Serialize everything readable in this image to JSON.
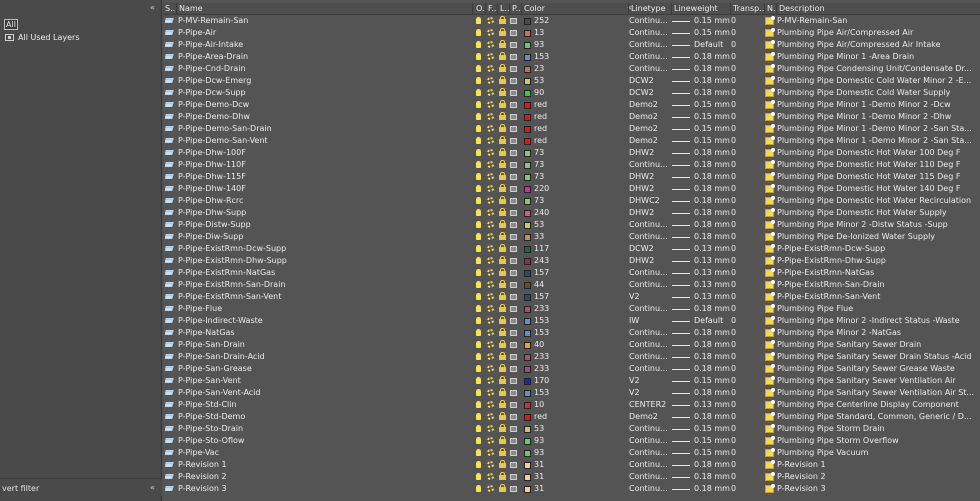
{
  "filter_tree": {
    "collapse_glyph": "«",
    "items": [
      {
        "label": "All"
      },
      {
        "label": "All Used Layers"
      }
    ],
    "invert_filter_label": "vert filter"
  },
  "columns": {
    "status": "S..",
    "name": "Name",
    "on": "O..",
    "freeze": "F..",
    "lock": "L..",
    "plot": "P..",
    "color": "Color",
    "linetype": "Linetype",
    "lineweight": "Lineweight",
    "transparency": "Transp...",
    "new_vp_freeze": "N..",
    "description": "Description"
  },
  "colors": {
    "252": "#4a4a4a",
    "13": "#d2686c",
    "93": "#5fd05f",
    "153": "#5f91cf",
    "23": "#d36a4f",
    "53": "#c8c866",
    "90": "#18e02a",
    "red": "#ee1111",
    "73": "#86c770",
    "220": "#e020b0",
    "240": "#e2547c",
    "33": "#c88a58",
    "117": "#1d6a3a",
    "243": "#9a2a4a",
    "157": "#2b4a66",
    "44": "#6a4e12",
    "233": "#a84d7b",
    "40": "#eda61a",
    "170": "#2020c8",
    "10": "#ee2222",
    "31": "#f5cd98"
  },
  "layers": [
    {
      "name": "P-MV-Remain-San",
      "color": "252",
      "linetype": "Continu...",
      "lineweight": "0.15 mm",
      "transparency": "0",
      "description": "P-MV-Remain-San"
    },
    {
      "name": "P-Pipe-Air",
      "color": "13",
      "linetype": "Continu...",
      "lineweight": "0.15 mm",
      "transparency": "0",
      "description": "Plumbing Pipe Air/Compressed Air"
    },
    {
      "name": "P-Pipe-Air-Intake",
      "color": "93",
      "linetype": "Continu...",
      "lineweight": "Default",
      "transparency": "0",
      "description": "Plumbing Pipe Air/Compressed Air Intake"
    },
    {
      "name": "P-Pipe-Area-Drain",
      "color": "153",
      "linetype": "Continu...",
      "lineweight": "0.18 mm",
      "transparency": "0",
      "description": "Plumbing Pipe Minor 1 -Area Drain"
    },
    {
      "name": "P-Pipe-Cnd-Drain",
      "color": "23",
      "linetype": "Continu...",
      "lineweight": "0.18 mm",
      "transparency": "0",
      "description": "Plumbing  Pipe Condensing  Unit/Condensate  Dr..."
    },
    {
      "name": "P-Pipe-Dcw-Emerg",
      "color": "53",
      "linetype": "DCW2",
      "lineweight": "0.18 mm",
      "transparency": "0",
      "description": "Plumbing Pipe Domestic Cold Water Minor 2 -E..."
    },
    {
      "name": "P-Pipe-Dcw-Supp",
      "color": "90",
      "linetype": "DCW2",
      "lineweight": "0.18 mm",
      "transparency": "0",
      "description": "Plumbing Pipe Domestic Cold Water Supply"
    },
    {
      "name": "P-Pipe-Demo-Dcw",
      "color": "red",
      "linetype": "Demo2",
      "lineweight": "0.15 mm",
      "transparency": "0",
      "description": "Plumbing Pipe Minor 1 -Demo Minor 2 -Dcw"
    },
    {
      "name": "P-Pipe-Demo-Dhw",
      "color": "red",
      "linetype": "Demo2",
      "lineweight": "0.15 mm",
      "transparency": "0",
      "description": "Plumbing Pipe Minor 1 -Demo Minor 2 -Dhw"
    },
    {
      "name": "P-Pipe-Demo-San-Drain",
      "color": "red",
      "linetype": "Demo2",
      "lineweight": "0.15 mm",
      "transparency": "0",
      "description": "Plumbing Pipe Minor 1 -Demo Minor 2 -San Sta..."
    },
    {
      "name": "P-Pipe-Demo-San-Vent",
      "color": "red",
      "linetype": "Demo2",
      "lineweight": "0.15 mm",
      "transparency": "0",
      "description": "Plumbing Pipe Minor 1 -Demo Minor 2 -San Sta..."
    },
    {
      "name": "P-Pipe-Dhw-100F",
      "color": "73",
      "linetype": "DHW2",
      "lineweight": "0.18 mm",
      "transparency": "0",
      "description": "Plumbing Pipe Domestic Hot Water 100 Deg F"
    },
    {
      "name": "P-Pipe-Dhw-110F",
      "color": "73",
      "linetype": "Continu...",
      "lineweight": "0.18 mm",
      "transparency": "0",
      "description": "Plumbing Pipe Domestic Hot Water 110 Deg F"
    },
    {
      "name": "P-Pipe-Dhw-115F",
      "color": "73",
      "linetype": "DHW2",
      "lineweight": "0.18 mm",
      "transparency": "0",
      "description": "Plumbing Pipe Domestic Hot Water 115 Deg F"
    },
    {
      "name": "P-Pipe-Dhw-140F",
      "color": "220",
      "linetype": "DHW2",
      "lineweight": "0.18 mm",
      "transparency": "0",
      "description": "Plumbing Pipe Domestic Hot Water 140 Deg F"
    },
    {
      "name": "P-Pipe-Dhw-Rcrc",
      "color": "73",
      "linetype": "DHWC2",
      "lineweight": "0.18 mm",
      "transparency": "0",
      "description": "Plumbing Pipe Domestic Hot Water Recirculation"
    },
    {
      "name": "P-Pipe-Dhw-Supp",
      "color": "240",
      "linetype": "DHW2",
      "lineweight": "0.18 mm",
      "transparency": "0",
      "description": "Plumbing Pipe Domestic Hot Water Supply"
    },
    {
      "name": "P-Pipe-Distw-Supp",
      "color": "53",
      "linetype": "Continu...",
      "lineweight": "0.18 mm",
      "transparency": "0",
      "description": "Plumbing Pipe Minor 2 -Distw Status -Supp"
    },
    {
      "name": "P-Pipe-Diw-Supp",
      "color": "33",
      "linetype": "Continu...",
      "lineweight": "0.18 mm",
      "transparency": "0",
      "description": "Plumbing Pipe De-Ionized Water Supply"
    },
    {
      "name": "P-Pipe-ExistRmn-Dcw-Supp",
      "color": "117",
      "linetype": "DCW2",
      "lineweight": "0.13 mm",
      "transparency": "0",
      "description": "P-Pipe-ExistRmn-Dcw-Supp"
    },
    {
      "name": "P-Pipe-ExistRmn-Dhw-Supp",
      "color": "243",
      "linetype": "DHW2",
      "lineweight": "0.13 mm",
      "transparency": "0",
      "description": "P-Pipe-ExistRmn-Dhw-Supp"
    },
    {
      "name": "P-Pipe-ExistRmn-NatGas",
      "color": "157",
      "linetype": "Continu...",
      "lineweight": "0.13 mm",
      "transparency": "0",
      "description": "P-Pipe-ExistRmn-NatGas"
    },
    {
      "name": "P-Pipe-ExistRmn-San-Drain",
      "color": "44",
      "linetype": "Continu...",
      "lineweight": "0.13 mm",
      "transparency": "0",
      "description": "P-Pipe-ExistRmn-San-Drain"
    },
    {
      "name": "P-Pipe-ExistRmn-San-Vent",
      "color": "157",
      "linetype": "V2",
      "lineweight": "0.13 mm",
      "transparency": "0",
      "description": "P-Pipe-ExistRmn-San-Vent"
    },
    {
      "name": "P-Pipe-Flue",
      "color": "233",
      "linetype": "Continu...",
      "lineweight": "0.18 mm",
      "transparency": "0",
      "description": "Plumbing Pipe Flue"
    },
    {
      "name": "P-Pipe-Indirect-Waste",
      "color": "153",
      "linetype": "IW",
      "lineweight": "Default",
      "transparency": "0",
      "description": "Plumbing Pipe Minor 2 -Indirect Status -Waste"
    },
    {
      "name": "P-Pipe-NatGas",
      "color": "153",
      "linetype": "Continu...",
      "lineweight": "0.18 mm",
      "transparency": "0",
      "description": "Plumbing Pipe Minor 2 -NatGas"
    },
    {
      "name": "P-Pipe-San-Drain",
      "color": "40",
      "linetype": "Continu...",
      "lineweight": "0.18 mm",
      "transparency": "0",
      "description": "Plumbing Pipe Sanitary Sewer Drain"
    },
    {
      "name": "P-Pipe-San-Drain-Acid",
      "color": "233",
      "linetype": "Continu...",
      "lineweight": "0.18 mm",
      "transparency": "0",
      "description": "Plumbing Pipe Sanitary Sewer Drain Status -Acid"
    },
    {
      "name": "P-Pipe-San-Grease",
      "color": "233",
      "linetype": "Continu...",
      "lineweight": "0.18 mm",
      "transparency": "0",
      "description": "Plumbing Pipe Sanitary Sewer Grease Waste"
    },
    {
      "name": "P-Pipe-San-Vent",
      "color": "170",
      "linetype": "V2",
      "lineweight": "0.15 mm",
      "transparency": "0",
      "description": "Plumbing Pipe Sanitary Sewer Ventilation Air"
    },
    {
      "name": "P-Pipe-San-Vent-Acid",
      "color": "153",
      "linetype": "V2",
      "lineweight": "0.18 mm",
      "transparency": "0",
      "description": "Plumbing Pipe Sanitary Sewer Ventilation Air St..."
    },
    {
      "name": "P-Pipe-Std-Clin",
      "color": "10",
      "linetype": "CENTER2",
      "lineweight": "0.13 mm",
      "transparency": "0",
      "description": "Plumbing Pipe Centerline Display Component"
    },
    {
      "name": "P-Pipe-Std-Demo",
      "color": "red",
      "linetype": "Demo2",
      "lineweight": "0.18 mm",
      "transparency": "0",
      "description": "Plumbing Pipe Standard, Common, Generic / D..."
    },
    {
      "name": "P-Pipe-Sto-Drain",
      "color": "53",
      "linetype": "Continu...",
      "lineweight": "0.15 mm",
      "transparency": "0",
      "description": "Plumbing Pipe Storm Drain"
    },
    {
      "name": "P-Pipe-Sto-Oflow",
      "color": "93",
      "linetype": "Continu...",
      "lineweight": "0.15 mm",
      "transparency": "0",
      "description": "Plumbing Pipe Storm Overflow"
    },
    {
      "name": "P-Pipe-Vac",
      "color": "93",
      "linetype": "Continu...",
      "lineweight": "0.15 mm",
      "transparency": "0",
      "description": "Plumbing Pipe Vacuum"
    },
    {
      "name": "P-Revision 1",
      "color": "31",
      "linetype": "Continu...",
      "lineweight": "0.18 mm",
      "transparency": "0",
      "description": "P-Revision 1"
    },
    {
      "name": "P-Revision 2",
      "color": "31",
      "linetype": "Continu...",
      "lineweight": "0.18 mm",
      "transparency": "0",
      "description": "P-Revision 2"
    },
    {
      "name": "P-Revision 3",
      "color": "31",
      "linetype": "Continu...",
      "lineweight": "0.18 mm",
      "transparency": "0",
      "description": "P-Revision 3"
    }
  ]
}
